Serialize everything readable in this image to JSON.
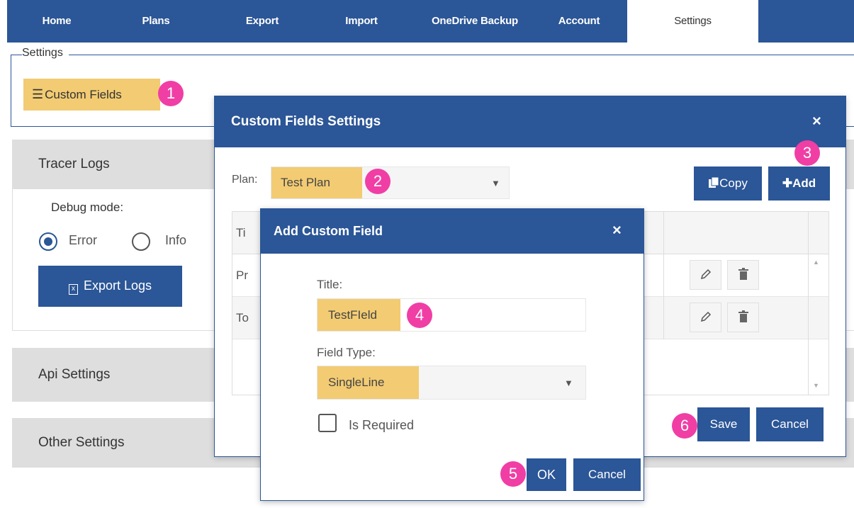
{
  "nav": {
    "tabs": [
      {
        "label": "Home"
      },
      {
        "label": "Plans"
      },
      {
        "label": "Export"
      },
      {
        "label": "Import"
      },
      {
        "label": "OneDrive Backup"
      },
      {
        "label": "Account"
      },
      {
        "label": "Settings",
        "active": true
      }
    ]
  },
  "settings": {
    "legend": "Settings",
    "custom_fields_button": "Custom Fields"
  },
  "panels": {
    "tracer_logs": {
      "title": "Tracer Logs",
      "debug_label": "Debug mode:",
      "options": [
        "Error",
        "Info"
      ],
      "selected": "Error",
      "export_button": "Export Logs"
    },
    "api_settings": {
      "title": "Api Settings"
    },
    "other_settings": {
      "title": "Other Settings"
    }
  },
  "custom_fields_dialog": {
    "title": "Custom Fields Settings",
    "close_glyph": "×",
    "plan_label": "Plan:",
    "plan_value": "Test Plan",
    "copy_button": "Copy",
    "add_button": "Add",
    "grid": {
      "header_first": "Ti",
      "rows": [
        {
          "first": "Pr"
        },
        {
          "first": "To"
        }
      ]
    },
    "save_button": "Save",
    "cancel_button": "Cancel"
  },
  "add_field_dialog": {
    "title": "Add Custom Field",
    "close_glyph": "×",
    "title_label": "Title:",
    "title_value": "TestFIeld",
    "field_type_label": "Field Type:",
    "field_type_value": "SingleLine",
    "required_label": "Is Required",
    "ok_button": "OK",
    "cancel_button": "Cancel"
  },
  "badges": [
    "1",
    "2",
    "3",
    "4",
    "5",
    "6"
  ],
  "colors": {
    "primary": "#2b5697",
    "highlight": "#f2cb73",
    "badge": "#f03ea5",
    "panel_header": "#dedede"
  }
}
